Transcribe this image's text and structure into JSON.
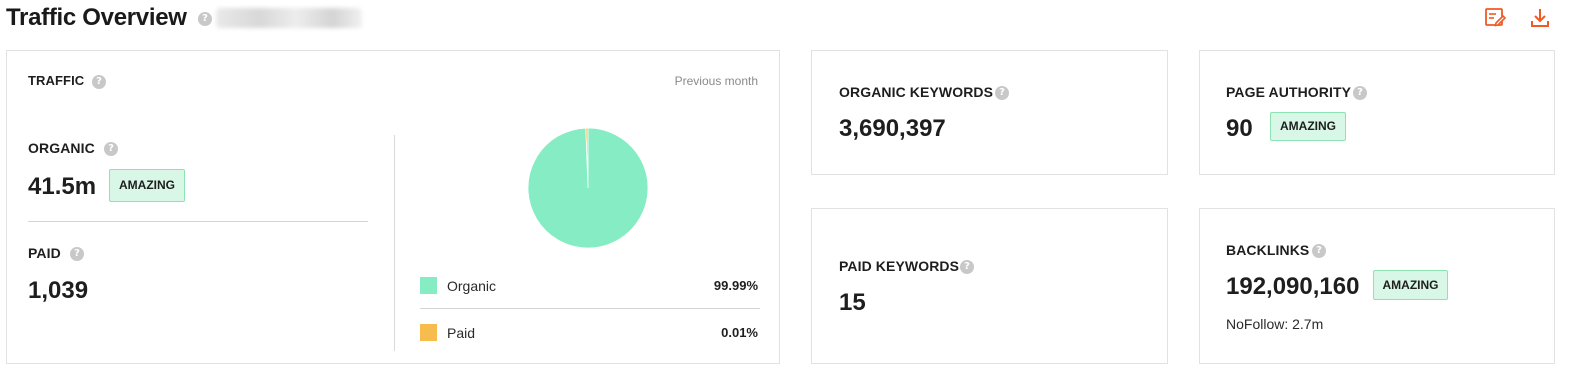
{
  "header": {
    "title": "Traffic Overview",
    "help_icon": "question-icon",
    "actions": [
      {
        "name": "edit-note",
        "icon": "edit-note-icon"
      },
      {
        "name": "download",
        "icon": "download-icon"
      }
    ]
  },
  "colors": {
    "organic": "#86ecc3",
    "paid": "#f6bc4e",
    "accent": "#f15a24",
    "badge_bg": "#d8f7e6",
    "badge_border": "#8ee3b4"
  },
  "traffic": {
    "label": "TRAFFIC",
    "period": "Previous month",
    "organic": {
      "label": "ORGANIC",
      "value": "41.5m",
      "badge": "AMAZING"
    },
    "paid": {
      "label": "PAID",
      "value": "1,039"
    },
    "legend": [
      {
        "name": "Organic",
        "percent": "99.99%"
      },
      {
        "name": "Paid",
        "percent": "0.01%"
      }
    ]
  },
  "chart_data": {
    "type": "pie",
    "categories": [
      "Organic",
      "Paid"
    ],
    "values": [
      99.99,
      0.01
    ]
  },
  "organic_keywords": {
    "label": "ORGANIC KEYWORDS",
    "value": "3,690,397"
  },
  "paid_keywords": {
    "label": "PAID KEYWORDS",
    "value": "15"
  },
  "page_authority": {
    "label": "PAGE AUTHORITY",
    "value": "90",
    "badge": "AMAZING"
  },
  "backlinks": {
    "label": "BACKLINKS",
    "value": "192,090,160",
    "badge": "AMAZING",
    "nofollow": "NoFollow: 2.7m"
  }
}
